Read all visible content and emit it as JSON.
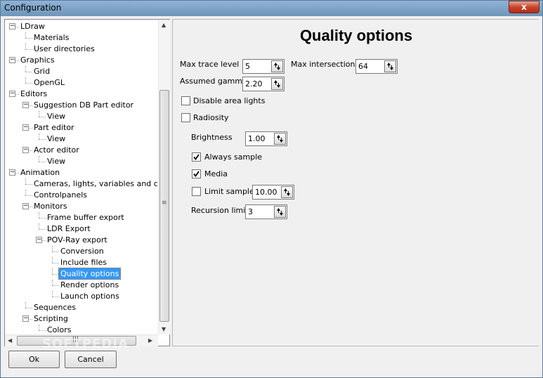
{
  "window": {
    "title": "Configuration",
    "close_label": "x"
  },
  "tree": {
    "items": [
      {
        "label": "LDraw"
      },
      {
        "label": "Materials"
      },
      {
        "label": "User directories"
      },
      {
        "label": "Graphics"
      },
      {
        "label": "Grid"
      },
      {
        "label": "OpenGL"
      },
      {
        "label": "Editors"
      },
      {
        "label": "Suggestion DB Part editor"
      },
      {
        "label": "View"
      },
      {
        "label": "Part editor"
      },
      {
        "label": "View"
      },
      {
        "label": "Actor editor"
      },
      {
        "label": "View"
      },
      {
        "label": "Animation"
      },
      {
        "label": "Cameras, lights, variables and chara"
      },
      {
        "label": "Controlpanels"
      },
      {
        "label": "Monitors"
      },
      {
        "label": "Frame buffer export"
      },
      {
        "label": "LDR Export"
      },
      {
        "label": "POV-Ray export"
      },
      {
        "label": "Conversion"
      },
      {
        "label": "Include files"
      },
      {
        "label": "Quality options"
      },
      {
        "label": "Render options"
      },
      {
        "label": "Launch options"
      },
      {
        "label": "Sequences"
      },
      {
        "label": "Scripting"
      },
      {
        "label": "Colors"
      }
    ]
  },
  "panel": {
    "heading": "Quality options",
    "max_trace_level": {
      "label": "Max trace level",
      "value": "5"
    },
    "max_intersections": {
      "label": "Max intersections",
      "value": "64"
    },
    "assumed_gamma": {
      "label": "Assumed gamma",
      "value": "2.20"
    },
    "disable_area_lights": {
      "label": "Disable area lights",
      "checked": false
    },
    "radiosity": {
      "label": "Radiosity",
      "checked": false
    },
    "brightness": {
      "label": "Brightness",
      "value": "1.00"
    },
    "always_sample": {
      "label": "Always sample",
      "checked": true
    },
    "media": {
      "label": "Media",
      "checked": true
    },
    "limit_sample": {
      "label": "Limit sample",
      "value": "10.00",
      "checked": false
    },
    "recursion_limit": {
      "label": "Recursion limit",
      "value": "3"
    }
  },
  "buttons": {
    "ok": "Ok",
    "cancel": "Cancel"
  },
  "watermark": "SOFTPEDIA"
}
